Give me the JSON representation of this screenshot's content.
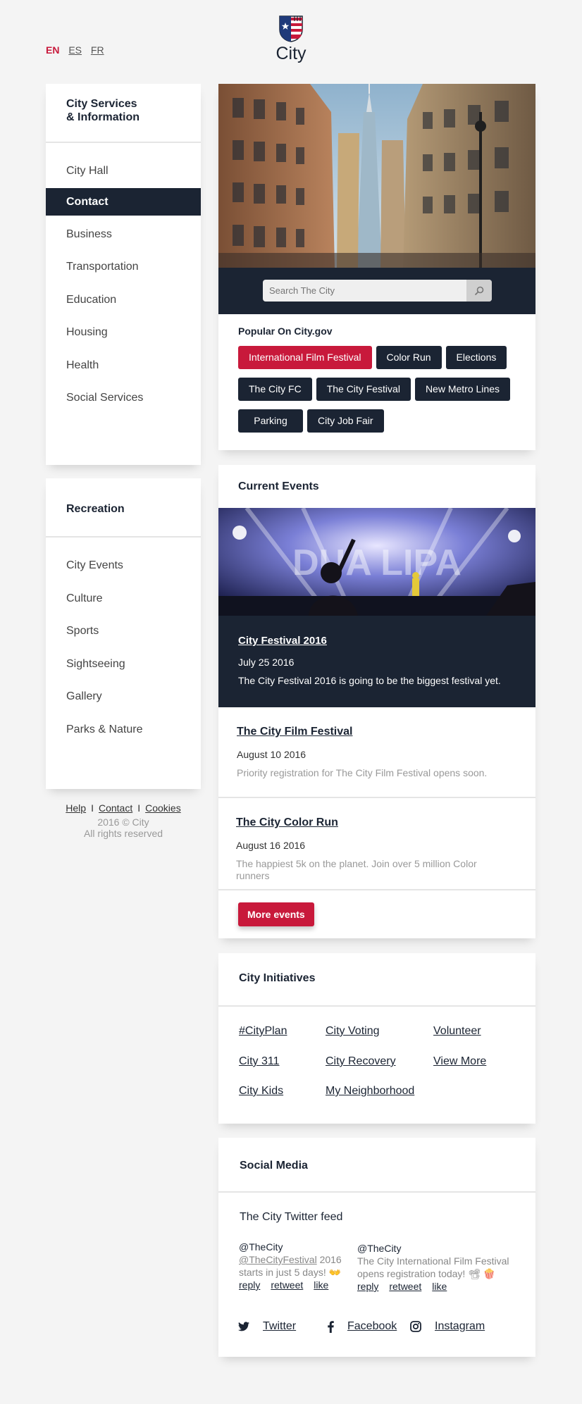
{
  "header": {
    "languages": [
      {
        "code": "EN",
        "active": true
      },
      {
        "code": "ES",
        "active": false
      },
      {
        "code": "FR",
        "active": false
      }
    ],
    "brand": "City"
  },
  "sidebar": {
    "services_title": "City Services & Information",
    "services_title_line1": "City Services",
    "services_title_line2": "& Information",
    "services": [
      "City Hall",
      "Contact",
      "Business",
      "Transportation",
      "Education",
      "Housing",
      "Health",
      "Social Services"
    ],
    "active_service": "Contact",
    "recreation_title": "Recreation",
    "recreation": [
      "City Events",
      "Culture",
      "Sports",
      "Sightseeing",
      "Gallery",
      "Parks & Nature"
    ]
  },
  "footer": {
    "links": [
      "Help",
      "Contact",
      "Cookies"
    ],
    "separator": "I",
    "copyright": "2016 © City",
    "rights": "All rights reserved"
  },
  "search": {
    "placeholder": "Search The City",
    "icon": "search-icon"
  },
  "popular": {
    "title": "Popular On City.gov",
    "tags": [
      "International Film Festival",
      "Color Run",
      "Elections",
      "The City FC",
      "The City Festival",
      "New Metro Lines",
      "Parking",
      "City Job Fair"
    ],
    "highlighted": "International Film Festival"
  },
  "events": {
    "title": "Current Events",
    "featured": {
      "title": "City Festival 2016",
      "date": "July 25 2016",
      "desc": "The City Festival 2016 is going to be the biggest festival yet."
    },
    "items": [
      {
        "title": "The City Film Festival",
        "date": "August 10 2016",
        "desc": "Priority registration for The City Film Festival opens soon."
      },
      {
        "title": "The City Color Run",
        "date": "August 16 2016",
        "desc": "The happiest 5k on the planet. Join over 5 million Color runners"
      }
    ],
    "more_label": "More events"
  },
  "initiatives": {
    "title": "City Initiatives",
    "links": [
      "#CityPlan",
      "City Voting",
      "Volunteer",
      "City 311",
      "City Recovery",
      "View More",
      "City Kids",
      "My Neighborhood"
    ]
  },
  "social": {
    "title": "Social Media",
    "feed_title": "The City Twitter feed",
    "tweets": [
      {
        "user": "@TheCity",
        "mention": "@TheCityFestival",
        "text": "2016 starts in just 5 days! 👐"
      },
      {
        "user": "@TheCity",
        "mention": "",
        "text": "The City International Film Festival opens registration today! 📽 🍿"
      }
    ],
    "actions": [
      "reply",
      "retweet",
      "like"
    ],
    "networks": [
      {
        "name": "Twitter",
        "icon": "twitter-icon"
      },
      {
        "name": "Facebook",
        "icon": "facebook-icon"
      },
      {
        "name": "Instagram",
        "icon": "instagram-icon"
      }
    ]
  },
  "colors": {
    "navy": "#1b2433",
    "accent": "#c8193b",
    "background": "#f4f4f4"
  }
}
